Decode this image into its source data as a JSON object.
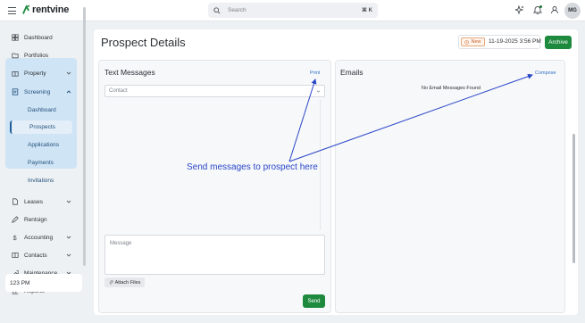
{
  "header": {
    "logo_text": "rentvine",
    "search_placeholder": "Search",
    "search_shortcut": "⌘ K",
    "avatar_initials": "MG"
  },
  "sidebar": {
    "items": [
      {
        "label": "Dashboard",
        "icon": "grid-icon"
      },
      {
        "label": "Portfolios",
        "icon": "folder-icon"
      },
      {
        "label": "Property",
        "icon": "building-icon",
        "has_chevron": true
      },
      {
        "label": "Screening",
        "icon": "screening-icon",
        "expanded": true
      },
      {
        "label": "Leases",
        "icon": "document-icon",
        "has_chevron": true
      },
      {
        "label": "Rentsign",
        "icon": "pen-icon"
      },
      {
        "label": "Accounting",
        "icon": "dollar-icon",
        "has_chevron": true
      },
      {
        "label": "Contacts",
        "icon": "contact-card-icon",
        "has_chevron": true
      },
      {
        "label": "Maintenance",
        "icon": "wrench-icon",
        "has_chevron": true
      },
      {
        "label": "Reports",
        "icon": "chart-icon"
      }
    ],
    "screening_sub": [
      "Dashboard",
      "Prospects",
      "Applications",
      "Payments",
      "Invitations"
    ],
    "active_sub": "Prospects",
    "footer_time": "123 PM"
  },
  "page": {
    "title": "Prospect Details",
    "status_badge": "New",
    "datetime": "11-19-2025 3:56 PM",
    "archive_label": "Archive"
  },
  "text_messages": {
    "title": "Text Messages",
    "print_label": "Print",
    "contact_placeholder": "Contact",
    "message_placeholder": "Message",
    "attach_label": "Attach Files",
    "send_label": "Send"
  },
  "emails": {
    "title": "Emails",
    "compose_label": "Compose",
    "empty_text": "No Email Messages Found"
  },
  "annotation": {
    "text": "Send messages to prospect here",
    "color": "#2946c8"
  },
  "colors": {
    "accent_green": "#1e8a3e",
    "link_blue": "#2f6fc4",
    "screening_bg": "#cfe4f5"
  }
}
